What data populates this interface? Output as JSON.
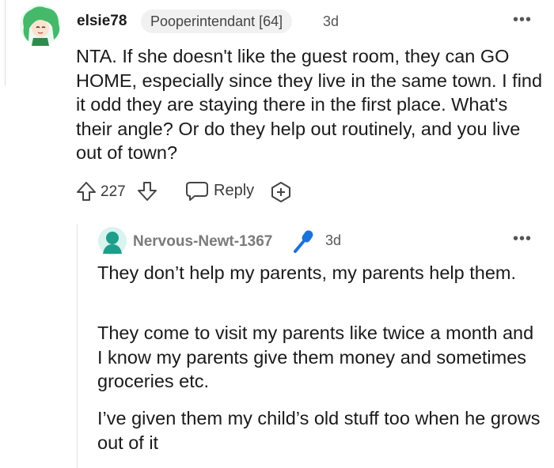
{
  "comment": {
    "author": "elsie78",
    "flair": "Pooperintendant [64]",
    "age": "3d",
    "more_icon": "ellipsis-icon",
    "body": "NTA. If she doesn't like the guest room, they can GO HOME, especially since they live in the same town. I find it odd they are staying there in the first place. What's their angle? Or do they help out routinely, and you live out of town?",
    "actions": {
      "score": "227",
      "reply_label": "Reply",
      "icons": [
        "upvote-arrow-icon",
        "downvote-arrow-icon",
        "reply-bubble-icon",
        "award-plus-icon"
      ]
    }
  },
  "reply": {
    "author": "Nervous-Newt-1367",
    "age": "3d",
    "more_icon": "ellipsis-icon",
    "paragraphs": [
      "They don’t help my parents, my parents help them.",
      "They come to visit my parents like twice a month and I know my parents give them money and sometimes groceries etc.",
      "I’ve given them my child’s old stuff too when he grows out of it"
    ]
  },
  "colors": {
    "accent_blue": "#1a73d9",
    "avatar_green": "#46b86a",
    "reply_avatar_teal": "#1e9e8a",
    "muted_text": "#555555"
  }
}
